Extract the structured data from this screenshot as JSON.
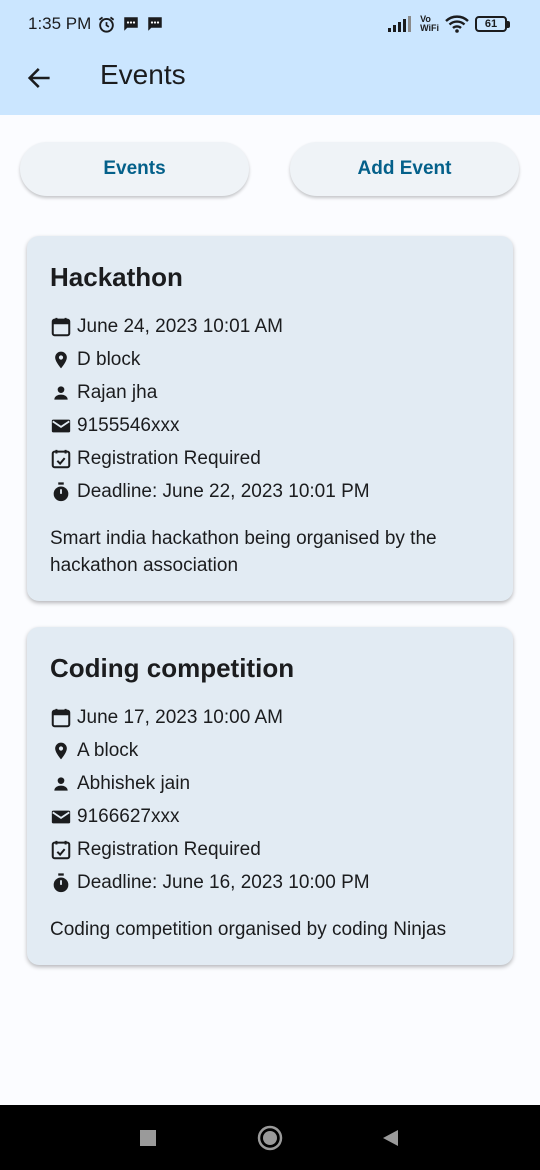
{
  "status_bar": {
    "time": "1:35 PM",
    "vowifi_top": "Vo",
    "vowifi_bottom": "WiFi",
    "battery": "61"
  },
  "app_bar": {
    "title": "Events"
  },
  "buttons": {
    "events": "Events",
    "add_event": "Add Event"
  },
  "events": [
    {
      "title": "Hackathon",
      "date": "June 24, 2023 10:01 AM",
      "location": "D block",
      "organizer": "Rajan jha",
      "contact": "9155546xxx",
      "registration": "Registration Required",
      "deadline": "Deadline: June 22, 2023 10:01 PM",
      "description": "Smart india hackathon being organised by the hackathon association"
    },
    {
      "title": "Coding competition",
      "date": "June 17, 2023 10:00 AM",
      "location": "A block",
      "organizer": "Abhishek jain",
      "contact": "9166627xxx",
      "registration": "Registration Required",
      "deadline": "Deadline: June 16, 2023 10:00 PM",
      "description": "Coding competition organised by coding Ninjas"
    }
  ],
  "colors": {
    "app_bar": "#cbe6ff",
    "accent": "#04608a",
    "card": "#e2ebf3",
    "background": "#fbfcff"
  }
}
